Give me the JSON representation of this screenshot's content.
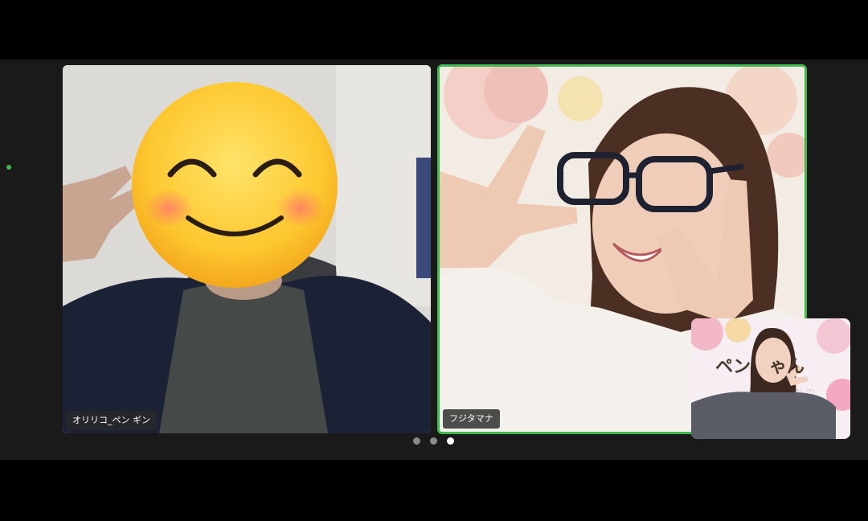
{
  "meeting": {
    "participants": [
      {
        "name": "オリリコ_ペン ギン",
        "active_speaker": false
      },
      {
        "name": "フジタマナ",
        "active_speaker": true
      }
    ],
    "self_view": {
      "banner_text": "ペン   ゃん",
      "hearts": "♡ ♡"
    },
    "pagination": {
      "total_pages": 3,
      "current_page": 3
    }
  },
  "colors": {
    "active_speaker_border": "#3fb950",
    "stage_background": "#1a1a1a",
    "letterbox": "#000000",
    "label_background": "#282828"
  }
}
